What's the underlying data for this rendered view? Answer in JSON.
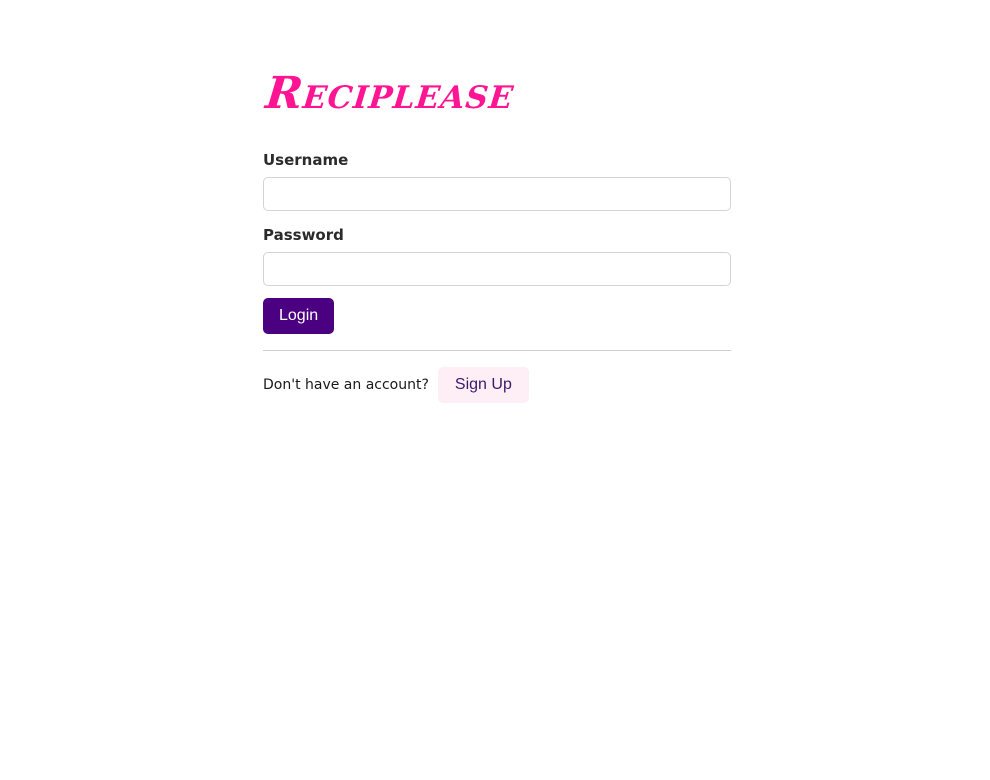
{
  "app": {
    "logo_text": "Reciplease",
    "brand_color": "#ff1493"
  },
  "form": {
    "username_label": "Username",
    "username_value": "",
    "password_label": "Password",
    "password_value": "",
    "login_label": "Login",
    "login_color": "#4b0082"
  },
  "signup": {
    "prompt": "Don't have an account?",
    "button_label": "Sign Up"
  }
}
